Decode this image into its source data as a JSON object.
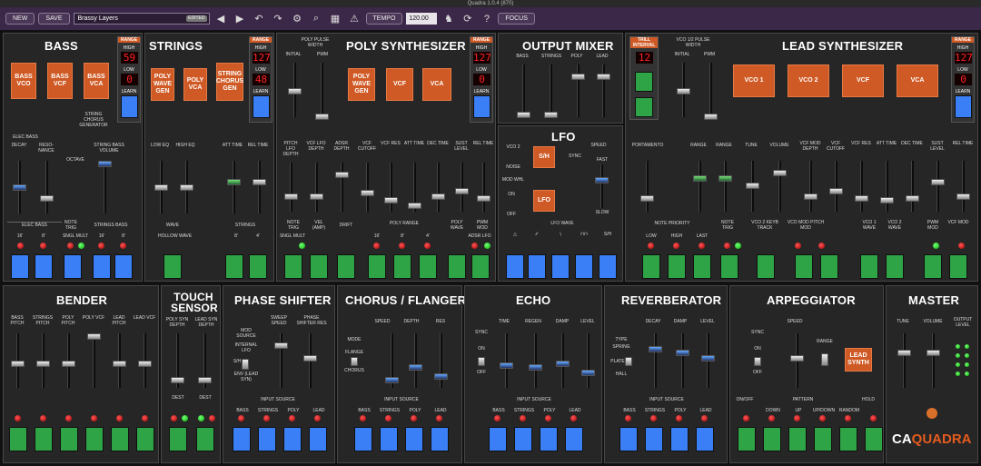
{
  "window": {
    "title": "Quadra 1.0.4 (870)"
  },
  "toolbar": {
    "new": "NEW",
    "save": "SAVE",
    "preset": "Brassy Layers",
    "preset_badge": "EDITED",
    "tempo_label": "TEMPO",
    "tempo_value": "120.00",
    "focus": "FOCUS"
  },
  "bass": {
    "title": "BASS",
    "vco": "BASS VCO",
    "vcf": "BASS VCF",
    "vca": "BASS VCA",
    "range": {
      "title": "RANGE",
      "high_label": "HIGH",
      "high": "59",
      "low_label": "LOW",
      "low": "0",
      "learn": "LEARN"
    },
    "sliders": [
      "DECAY",
      "RESO-NANCE",
      "OCTAVE",
      "STRING BASS VOLUME"
    ],
    "group1": "ELEC BASS",
    "group2": "STRINGS BASS",
    "btns": [
      "16'",
      "8'",
      "NOTE TRIG",
      "SNGL MULT",
      "16'",
      "8'"
    ],
    "chorus": "STRING CHORUS GENERATOR",
    "elecbass_top": "ELEC BASS"
  },
  "strings": {
    "title": "STRINGS",
    "gen": "POLY WAVE GEN",
    "vca": "POLY VCA",
    "chorus": "STRING CHORUS GEN",
    "range": {
      "title": "RANGE",
      "high_label": "HIGH",
      "high": "127",
      "low_label": "LOW",
      "low": "48",
      "learn": "LEARN"
    },
    "sliders": [
      "LOW EQ",
      "HIGH EQ",
      "ATT TIME",
      "REL TIME"
    ],
    "wave": "WAVE",
    "hollow": "HOLLOW WAVE",
    "group": "STRINGS",
    "btns": [
      "8'",
      "4'"
    ]
  },
  "poly": {
    "title": "POLY SYNTHESIZER",
    "pw": "POLY PULSE WIDTH",
    "initial": "INITIAL",
    "pwm": "PWM",
    "gen": "POLY WAVE GEN",
    "vcf": "VCF",
    "vca": "VCA",
    "range": {
      "title": "RANGE",
      "high_label": "HIGH",
      "high": "127",
      "low_label": "LOW",
      "low": "0",
      "learn": "LEARN"
    },
    "sliders": [
      "PITCH LFO DEPTH",
      "VCF LFO DEPTH",
      "ADSR DEPTH",
      "VCF CUTOFF",
      "VCF RES",
      "ATT TIME",
      "DEC TIME",
      "SUST LEVEL",
      "REL TIME"
    ],
    "btns": [
      "NOTE TRIG",
      "VEL (AMP)",
      "DRIFT",
      "16'",
      "8'",
      "4'",
      "POLY WAVE",
      "PWM MOD"
    ],
    "group": "POLY RANGE",
    "sub": [
      "SNGL MULT",
      "ADSR LFO"
    ]
  },
  "mixer": {
    "title": "OUTPUT MIXER",
    "channels": [
      "BASS",
      "STRINGS",
      "POLY",
      "LEAD"
    ]
  },
  "lfo": {
    "title": "LFO",
    "vco2": "VCO 2",
    "noise": "NOISE",
    "modwhl": "MOD WHL",
    "on": "ON",
    "off": "OFF",
    "sh": "S/H",
    "lfo": "LFO",
    "sync": "SYNC",
    "speed": "SPEED",
    "fast": "FAST",
    "slow": "SLOW",
    "wave": "LFO WAVE",
    "waves": [
      "△",
      "∕∕",
      "∖",
      "⊓⊓",
      "S/H"
    ]
  },
  "trill": {
    "title": "TRILL INTERVAL",
    "value": "12"
  },
  "lead": {
    "title": "LEAD SYNTHESIZER",
    "pw": "VCO 1/2 PULSE WIDTH",
    "initial": "INITIAL",
    "pwm": "PWM",
    "vco1": "VCO 1",
    "vco2": "VCO 2",
    "vcf": "VCF",
    "vca": "VCA",
    "range": {
      "title": "RANGE",
      "high_label": "HIGH",
      "high": "127",
      "low_label": "LOW",
      "low": "0",
      "learn": "LEARN"
    },
    "sliders": [
      "PORTAMENTO",
      "RANGE",
      "RANGE",
      "TUNE",
      "VOLUME",
      "VCF MOD DEPTH",
      "VCF CUTOFF",
      "VCF RES",
      "ATT TIME",
      "DEC TIME",
      "SUST LEVEL",
      "REL TIME"
    ],
    "priority": "NOTE PRIORITY",
    "btns": [
      "LOW",
      "HIGH",
      "LAST",
      "NOTE TRIG",
      "VCO 2 KEYB TRACK",
      "VCO MOD PITCH MOD",
      "VCO 1 WAVE",
      "VCO 2 WAVE",
      "PWM MOD",
      "VCF MOD"
    ]
  },
  "bender": {
    "title": "BENDER",
    "sliders": [
      "BASS PITCH",
      "STRINGS PITCH",
      "POLY PITCH",
      "POLY VCF",
      "LEAD PITCH",
      "LEAD VCF"
    ]
  },
  "touch": {
    "title": "TOUCH SENSOR",
    "sliders": [
      "POLY SYN DEPTH",
      "LEAD SYN DEPTH"
    ],
    "dest": "DEST"
  },
  "phaser": {
    "title": "PHASE SHIFTER",
    "mod": "MOD SOURCE",
    "int": "INTERNAL LFO",
    "sh": "S/H",
    "env": "ENV (LEAD SYN)",
    "sliders": [
      "SWEEP SPEED",
      "PHASE SHIFTER RES"
    ],
    "src": "INPUT SOURCE",
    "btns": [
      "BASS",
      "STRINGS",
      "POLY",
      "LEAD"
    ]
  },
  "chorus": {
    "title": "CHORUS / FLANGER",
    "mode": "MODE",
    "flange": "FLANGE",
    "chorus": "CHORUS",
    "sliders": [
      "SPEED",
      "DEPTH",
      "RES"
    ],
    "src": "INPUT SOURCE",
    "btns": [
      "BASS",
      "STRINGS",
      "POLY",
      "LEAD"
    ]
  },
  "echo": {
    "title": "ECHO",
    "sync": "SYNC",
    "on": "ON",
    "off": "OFF",
    "sliders": [
      "TIME",
      "REGEN",
      "DAMP",
      "LEVEL"
    ],
    "src": "INPUT SOURCE",
    "btns": [
      "BASS",
      "STRINGS",
      "POLY",
      "LEAD"
    ]
  },
  "reverb": {
    "title": "REVERBERATOR",
    "type": "TYPE",
    "spring": "SPRING",
    "plate": "PLATE",
    "hall": "HALL",
    "sliders": [
      "DECAY",
      "DAMP",
      "LEVEL"
    ],
    "src": "INPUT SOURCE",
    "btns": [
      "BASS",
      "STRINGS",
      "POLY",
      "LEAD"
    ]
  },
  "arp": {
    "title": "ARPEGGIATOR",
    "sync": "SYNC",
    "on": "ON",
    "off": "OFF",
    "speed": "SPEED",
    "range": "RANGE",
    "lead": "LEAD SYNTH",
    "onoff": "ON/OFF",
    "pattern": "PATTERN",
    "hold": "HOLD",
    "btns": [
      "DOWN",
      "UP",
      "UP/DOWN",
      "RANDOM"
    ]
  },
  "master": {
    "title": "MASTER",
    "sliders": [
      "TUNE",
      "VOLUME"
    ],
    "output": "OUTPUT LEVEL",
    "logo_a": "CA",
    "logo_b": "QUADRA"
  }
}
